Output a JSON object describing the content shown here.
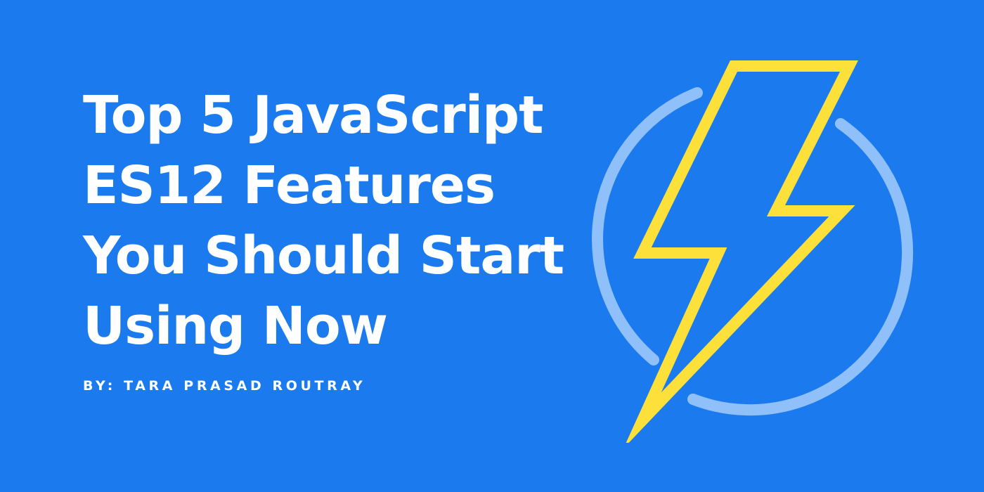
{
  "colors": {
    "background": "#1b7bee",
    "title_text": "#ffffff",
    "byline_text": "#ffffff",
    "ring": "#90c0f9",
    "bolt": "#fde03a"
  },
  "headline": {
    "lines": [
      "Top 5 JavaScript",
      "ES12 Features",
      "You Should Start",
      "Using Now"
    ]
  },
  "byline": "BY: TARA PRASAD ROUTRAY",
  "logo": {
    "icons": [
      "ring-icon",
      "lightning-bolt-icon"
    ]
  }
}
